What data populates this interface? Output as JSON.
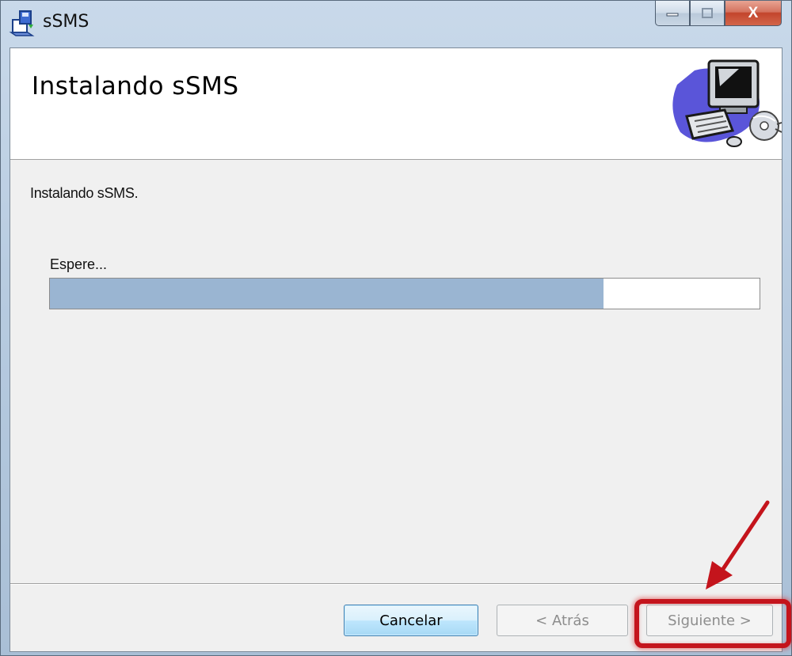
{
  "window": {
    "title": "sSMS",
    "icon": "installer-package-icon",
    "controls": {
      "minimize_icon": "minimize-icon",
      "maximize_icon": "maximize-icon",
      "close_label": "X"
    }
  },
  "banner": {
    "title": "Instalando sSMS",
    "art_icon": "computer-setup-icon"
  },
  "content": {
    "status_text": "Instalando sSMS.",
    "wait_label": "Espere...",
    "progress_percent": 78
  },
  "buttons": {
    "cancel_label": "Cancelar",
    "back_label": "< Atrás",
    "next_label": "Siguiente >"
  },
  "annotation": {
    "color": "#c4141c"
  },
  "colors": {
    "progress_fill": "#9ab5d2",
    "button_focus_border": "#3c7fb1",
    "disabled_text": "#8d8d8d"
  }
}
